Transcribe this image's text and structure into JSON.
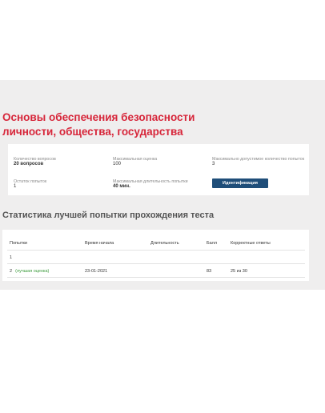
{
  "course": {
    "title": "Основы обеспечения безопасности личности, общества, государства"
  },
  "info": {
    "questions_label": "Количество вопросов",
    "questions_value": "20 вопросов",
    "attempts_used_label": "Остаток попыток",
    "attempts_used_value": "1",
    "max_score_label": "Максимальная оценка",
    "max_score_value": "100",
    "max_duration_label": "Максимальная длительность попытки",
    "max_duration_value": "40 мин.",
    "max_attempts_label": "Максимально допустимое количество попыток",
    "max_attempts_value": "3",
    "identify_button": "Идентификация"
  },
  "stats": {
    "heading": "Статистика лучшей попытки прохождения теста",
    "columns": {
      "attempts": "Попытки",
      "start_time": "Время начала",
      "duration": "Длительность",
      "score": "Балл",
      "correct": "Корректные ответы"
    },
    "rows": [
      {
        "attempt": "1",
        "best_label": "",
        "start_time": "",
        "duration": "",
        "score": "",
        "correct": ""
      },
      {
        "attempt": "2",
        "best_label": "(лучшая оценка)",
        "start_time": "23-01-2021",
        "duration": "",
        "score": "83",
        "correct": "25 из 30"
      }
    ]
  }
}
